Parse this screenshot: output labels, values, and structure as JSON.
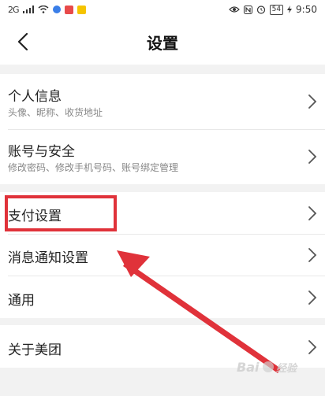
{
  "status_bar": {
    "signal": "2G",
    "time": "9:50",
    "battery": "54"
  },
  "header": {
    "title": "设置"
  },
  "sections": [
    {
      "rows": [
        {
          "label": "个人信息",
          "subtitle": "头像、昵称、收货地址"
        },
        {
          "label": "账号与安全",
          "subtitle": "修改密码、修改手机号码、账号绑定管理"
        }
      ]
    },
    {
      "rows": [
        {
          "label": "支付设置"
        },
        {
          "label": "消息通知设置"
        },
        {
          "label": "通用"
        }
      ]
    },
    {
      "rows": [
        {
          "label": "关于美团"
        }
      ]
    }
  ],
  "annotation": {
    "color": "#e0323a"
  }
}
